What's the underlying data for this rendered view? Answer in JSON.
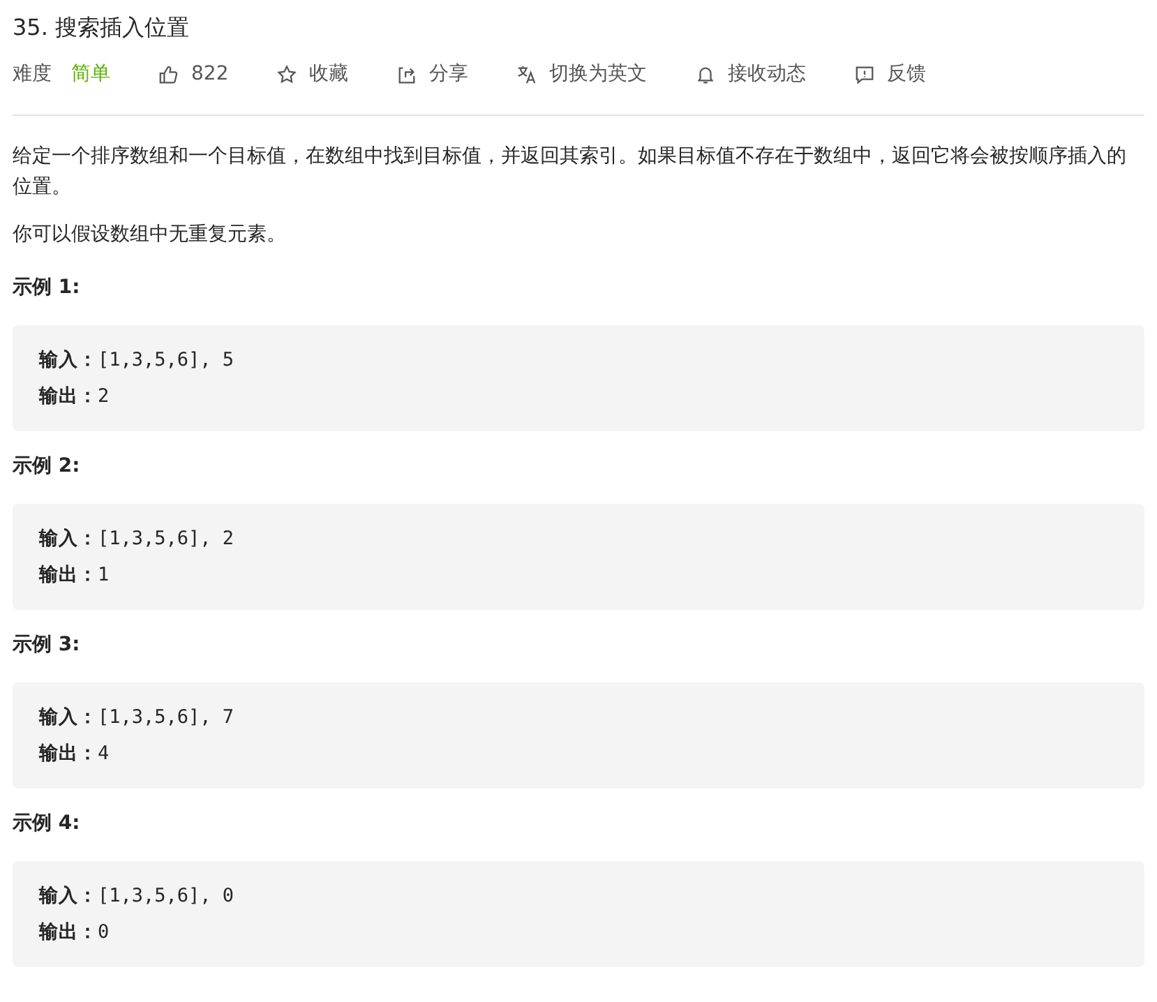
{
  "title": "35. 搜索插入位置",
  "meta": {
    "difficulty_label": "难度",
    "difficulty": "简单",
    "actions": [
      {
        "label": "822"
      },
      {
        "label": "收藏"
      },
      {
        "label": "分享"
      },
      {
        "label": "切换为英文"
      },
      {
        "label": "接收动态"
      },
      {
        "label": "反馈"
      }
    ]
  },
  "description": [
    "给定一个排序数组和一个目标值，在数组中找到目标值，并返回其索引。如果目标值不存在于数组中，返回它将会被按顺序插入的位置。",
    "你可以假设数组中无重复元素。"
  ],
  "examples": [
    {
      "heading": "示例 1:",
      "lines": [
        "**输入：**[1,3,5,6], 5",
        "**输出：**2"
      ]
    },
    {
      "heading": "示例 2:",
      "lines": [
        "**输入：**[1,3,5,6], 2",
        "**输出：**1"
      ]
    },
    {
      "heading": "示例 3:",
      "lines": [
        "**输入：**[1,3,5,6], 7",
        "**输出：**4"
      ]
    },
    {
      "heading": "示例 4:",
      "lines": [
        "**输入：**[1,3,5,6], 0",
        "**输出：**0"
      ]
    }
  ]
}
